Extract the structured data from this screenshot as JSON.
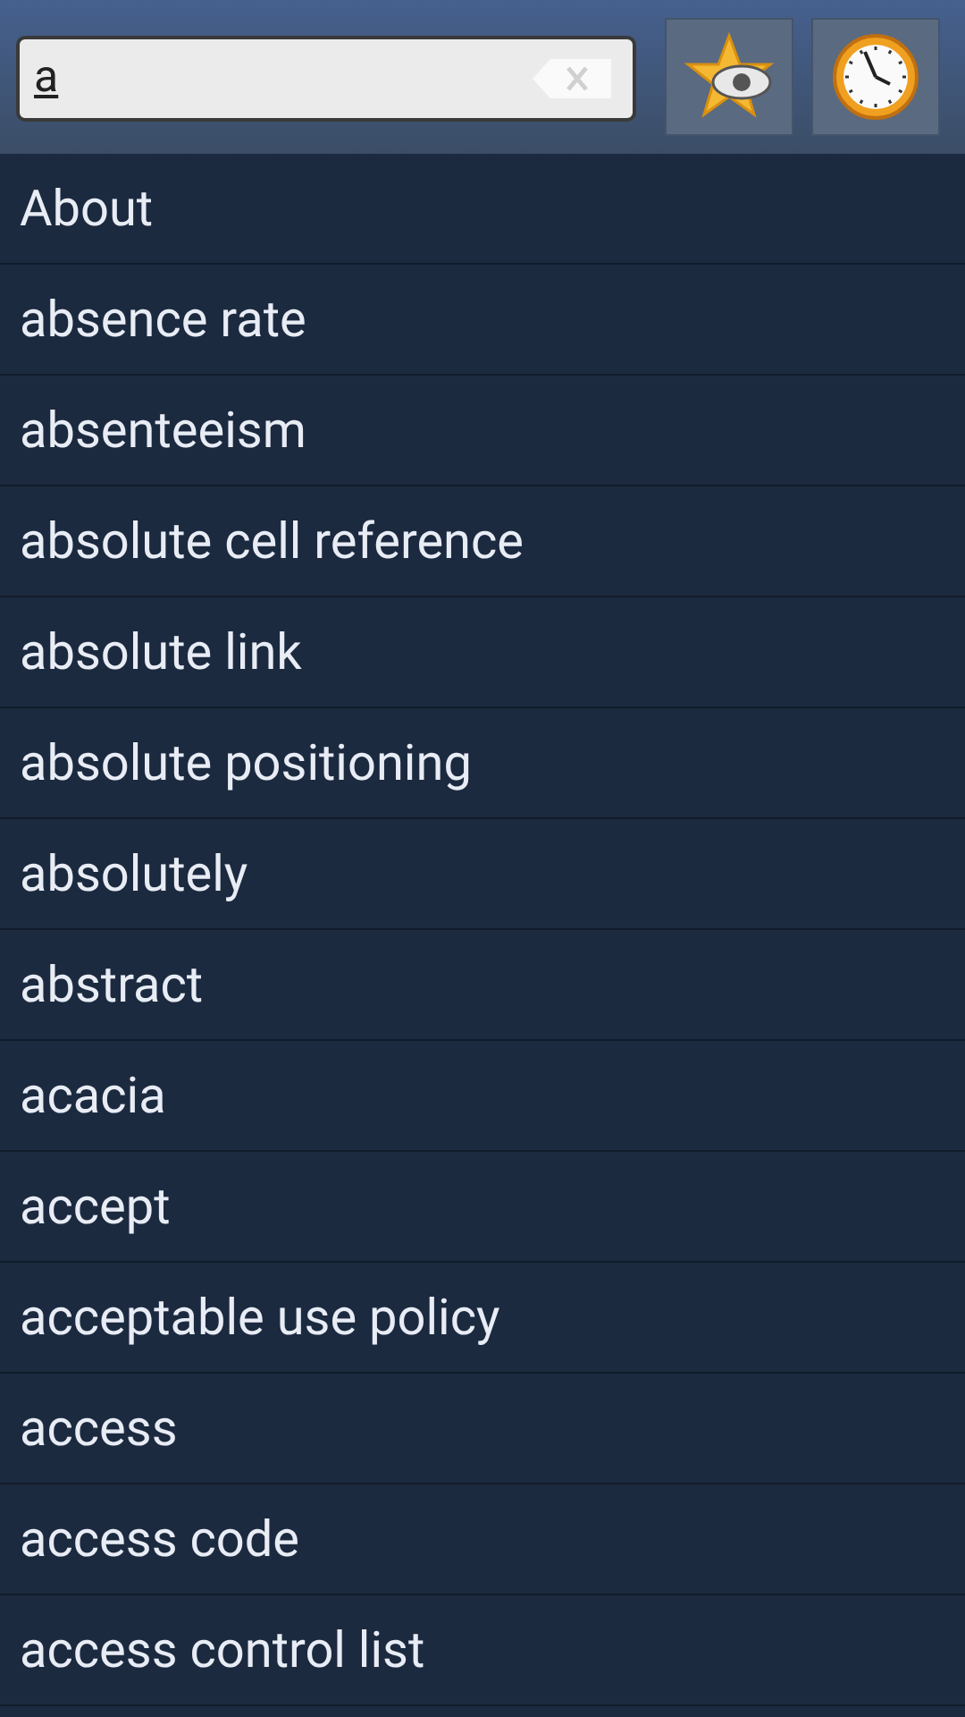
{
  "search": {
    "value": "a"
  },
  "words": [
    "About",
    "absence rate",
    "absenteeism",
    "absolute cell reference",
    "absolute link",
    "absolute positioning",
    "absolutely",
    "abstract",
    "acacia",
    "accept",
    "acceptable use policy",
    "access",
    "access code",
    "access control list"
  ]
}
